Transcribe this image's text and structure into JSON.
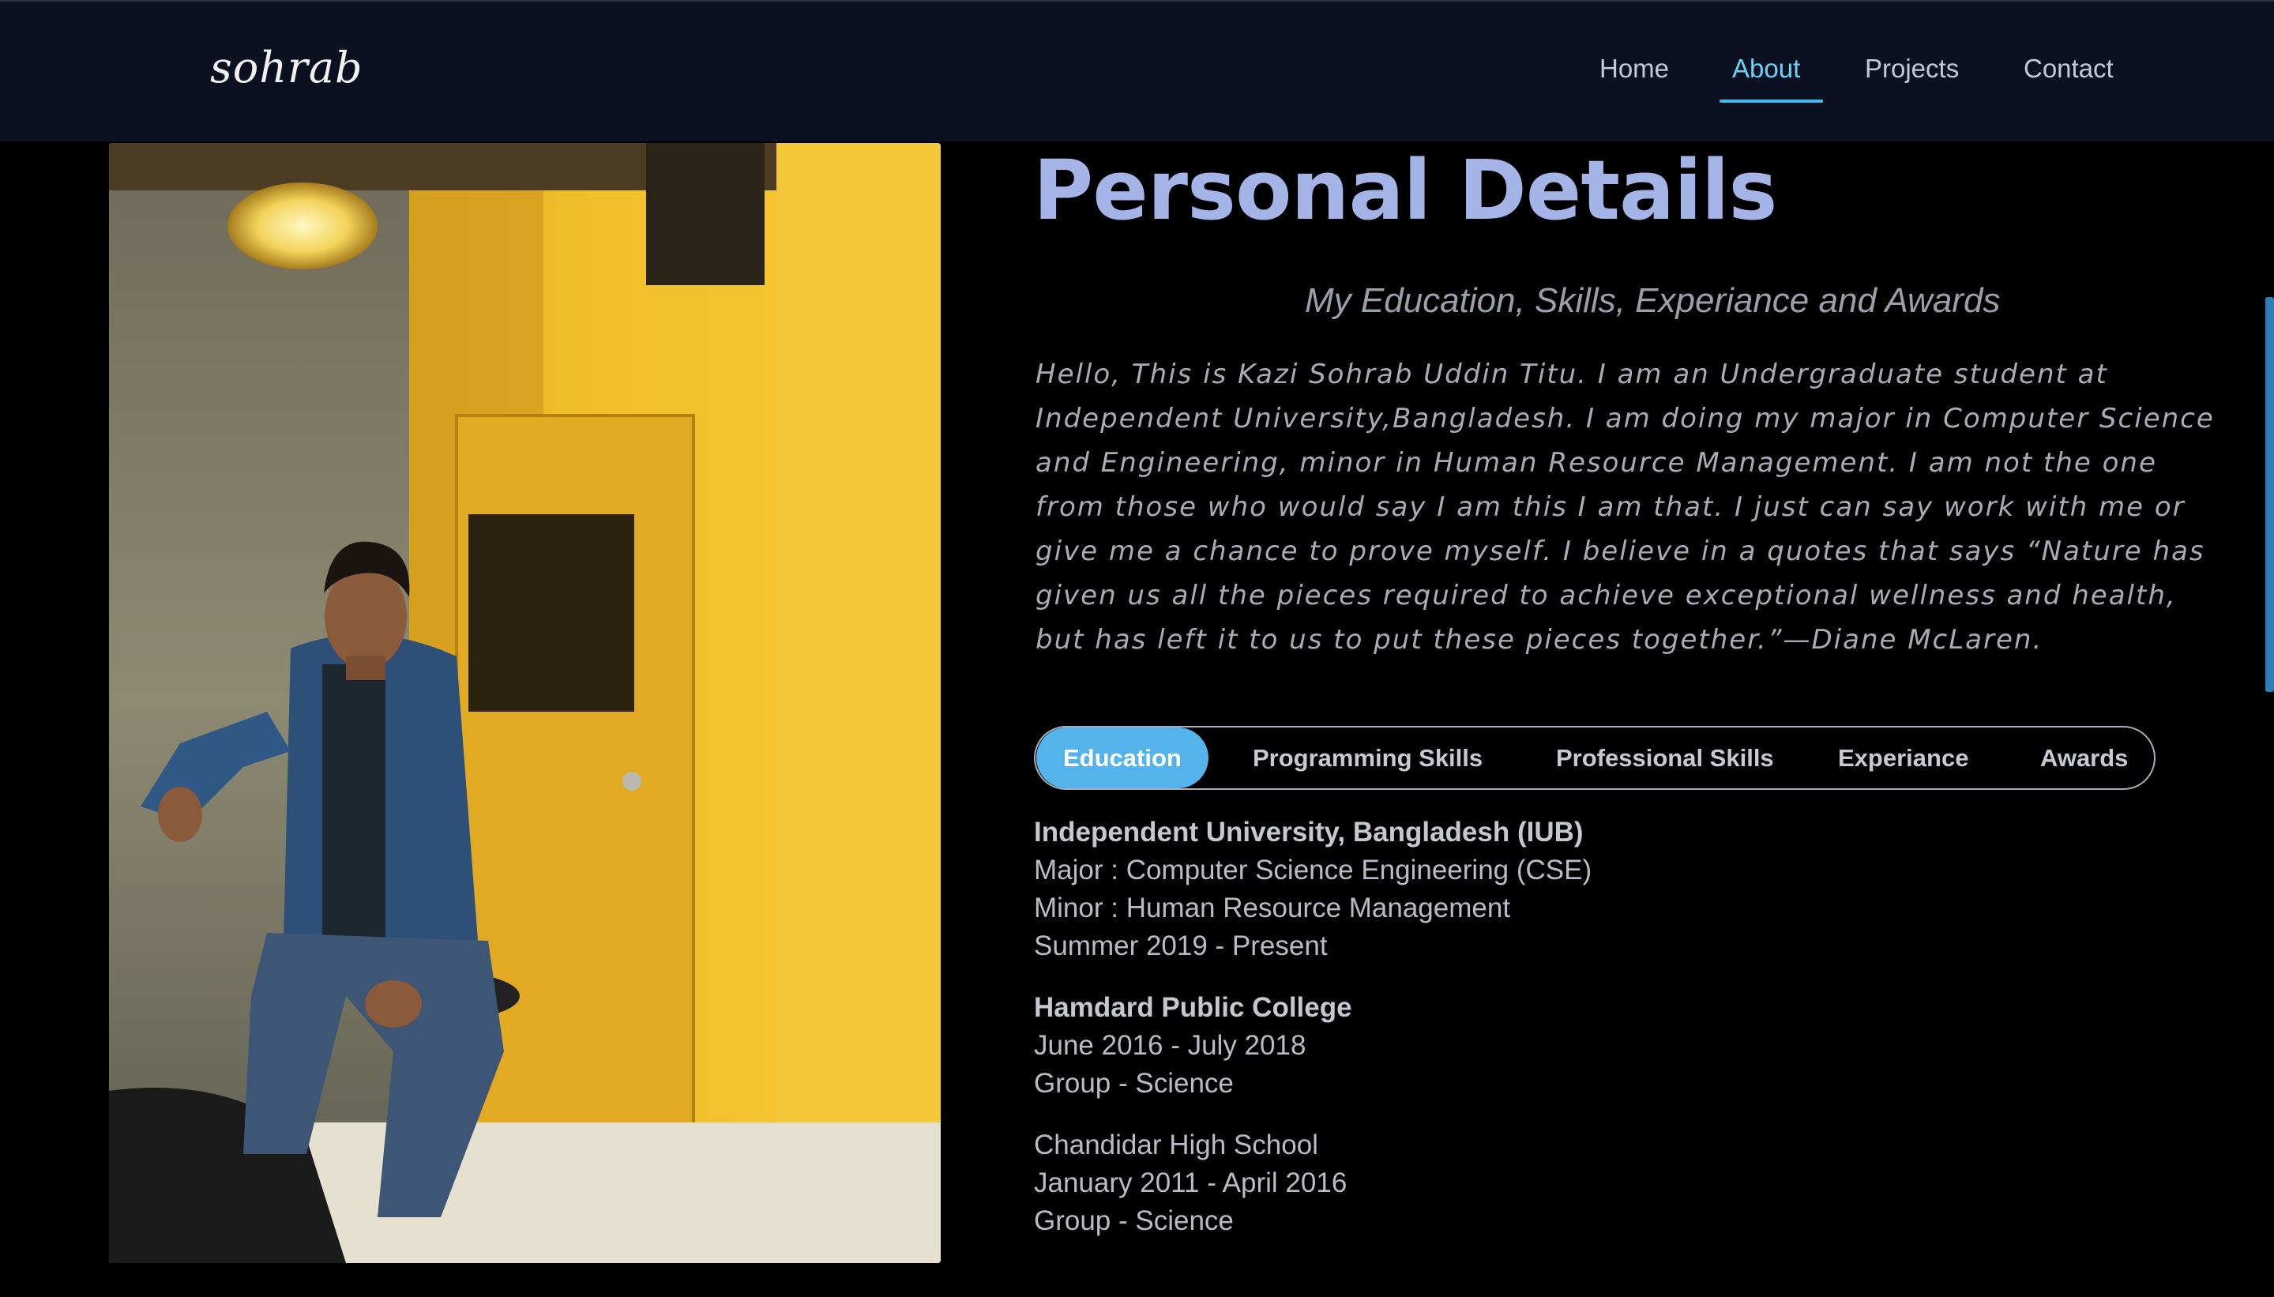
{
  "nav": {
    "brand": "sohrab",
    "links": [
      {
        "label": "Home"
      },
      {
        "label": "About"
      },
      {
        "label": "Projects"
      },
      {
        "label": "Contact"
      }
    ],
    "active": "About",
    "accent_color": "#48b8ec"
  },
  "photo": {
    "alt": "Portrait photo"
  },
  "about": {
    "title": "Personal Details",
    "subtitle": "My Education, Skills, Experiance and Awards",
    "bio_lines": [
      "Hello, This is Kazi Sohrab Uddin Titu. I am an Undergraduate student at",
      "Independent University,Bangladesh. I am doing my major in Computer Science",
      "and Engineering, minor in Human Resource Management. I am not the one",
      "from those who would say I am this I am that. I just can say work with me or",
      "give me a chance to prove myself. I believe in a quotes that says “Nature has",
      "given us all the pieces required to achieve exceptional wellness and health,",
      "but has left it to us to put these pieces together.”—Diane McLaren."
    ]
  },
  "tabs": {
    "items": [
      {
        "label": "Education"
      },
      {
        "label": "Programming Skills"
      },
      {
        "label": "Professional Skills"
      },
      {
        "label": "Experiance"
      },
      {
        "label": "Awards"
      }
    ],
    "active": "Education",
    "active_color": "#55b3ec"
  },
  "education": [
    {
      "institution": "Independent University, Bangladesh (IUB)",
      "lines": [
        "Major : Computer Science Engineering (CSE)",
        "Minor : Human Resource Management",
        "Summer 2019 - Present"
      ]
    },
    {
      "institution": "Hamdard Public College",
      "lines": [
        "June 2016 - July 2018",
        "Group - Science"
      ]
    },
    {
      "institution": "Chandidar High School",
      "lines": [
        "January 2011 - April 2016",
        "Group - Science"
      ]
    }
  ]
}
